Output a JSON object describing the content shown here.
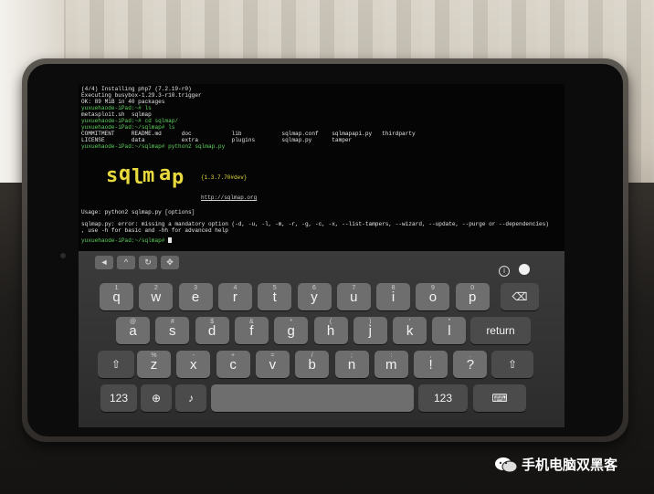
{
  "terminal": {
    "lines": [
      {
        "text": "(4/4) Installing php7 (7.2.19-r0)",
        "cls": ""
      },
      {
        "text": "Executing busybox-1.29.3-r10.trigger",
        "cls": ""
      },
      {
        "text": "OK: 89 MiB in 40 packages",
        "cls": ""
      },
      {
        "text": "yuxuehaode-iPad:~# ls",
        "cls": "g"
      },
      {
        "text": "metasploit.sh  sqlmap",
        "cls": ""
      },
      {
        "text": "yuxuehaode-iPad:~# cd sqlmap/",
        "cls": "g"
      },
      {
        "text": "yuxuehaode-iPad:~/sqlmap# ls",
        "cls": "g"
      },
      {
        "text": "COMMITMENT     README.md      doc            lib            sqlmap.conf    sqlmapapi.py   thirdparty",
        "cls": ""
      },
      {
        "text": "LICENSE        data           extra          plugins        sqlmap.py      tamper",
        "cls": ""
      },
      {
        "text": "yuxuehaode-iPad:~/sqlmap# python2 sqlmap.py",
        "cls": "g"
      }
    ],
    "logo_version": "{1.3.7.70#dev}",
    "logo_url": "http://sqlmap.org",
    "usage": "Usage: python2 sqlmap.py [options]",
    "error": "sqlmap.py: error: missing a mandatory option (-d, -u, -l, -m, -r, -g, -c, -x, --list-tampers, --wizard, --update, --purge or --dependencies)",
    "help": ", use -h for basic and -hh for advanced help",
    "prompt": "yuxuehaode-iPad:~/sqlmap# "
  },
  "keyboard": {
    "row1": [
      {
        "main": "q",
        "sub": "1"
      },
      {
        "main": "w",
        "sub": "2"
      },
      {
        "main": "e",
        "sub": "3"
      },
      {
        "main": "r",
        "sub": "4"
      },
      {
        "main": "t",
        "sub": "5"
      },
      {
        "main": "y",
        "sub": "6"
      },
      {
        "main": "u",
        "sub": "7"
      },
      {
        "main": "i",
        "sub": "8"
      },
      {
        "main": "o",
        "sub": "9"
      },
      {
        "main": "p",
        "sub": "0"
      }
    ],
    "row2": [
      {
        "main": "a",
        "sub": "@"
      },
      {
        "main": "s",
        "sub": "#"
      },
      {
        "main": "d",
        "sub": "$"
      },
      {
        "main": "f",
        "sub": "&"
      },
      {
        "main": "g",
        "sub": "*"
      },
      {
        "main": "h",
        "sub": "("
      },
      {
        "main": "j",
        "sub": ")"
      },
      {
        "main": "k",
        "sub": "'"
      },
      {
        "main": "l",
        "sub": "\""
      }
    ],
    "row3": [
      {
        "main": "z",
        "sub": "%"
      },
      {
        "main": "x",
        "sub": "-"
      },
      {
        "main": "c",
        "sub": "+"
      },
      {
        "main": "v",
        "sub": "="
      },
      {
        "main": "b",
        "sub": "/"
      },
      {
        "main": "n",
        "sub": ";"
      },
      {
        "main": "m",
        "sub": ":"
      },
      {
        "main": "!",
        "sub": ","
      },
      {
        "main": "?",
        "sub": "."
      }
    ],
    "return_label": "return",
    "numbers_label": "123",
    "numbers_label_right": "123",
    "icons": {
      "backspace": "backspace-icon",
      "shift": "shift-icon",
      "globe": "globe-icon",
      "mic": "microphone-icon",
      "hide": "keyboard-hide-icon"
    }
  },
  "watermark": {
    "text": "手机电脑双黑客",
    "icon": "wechat-icon"
  }
}
